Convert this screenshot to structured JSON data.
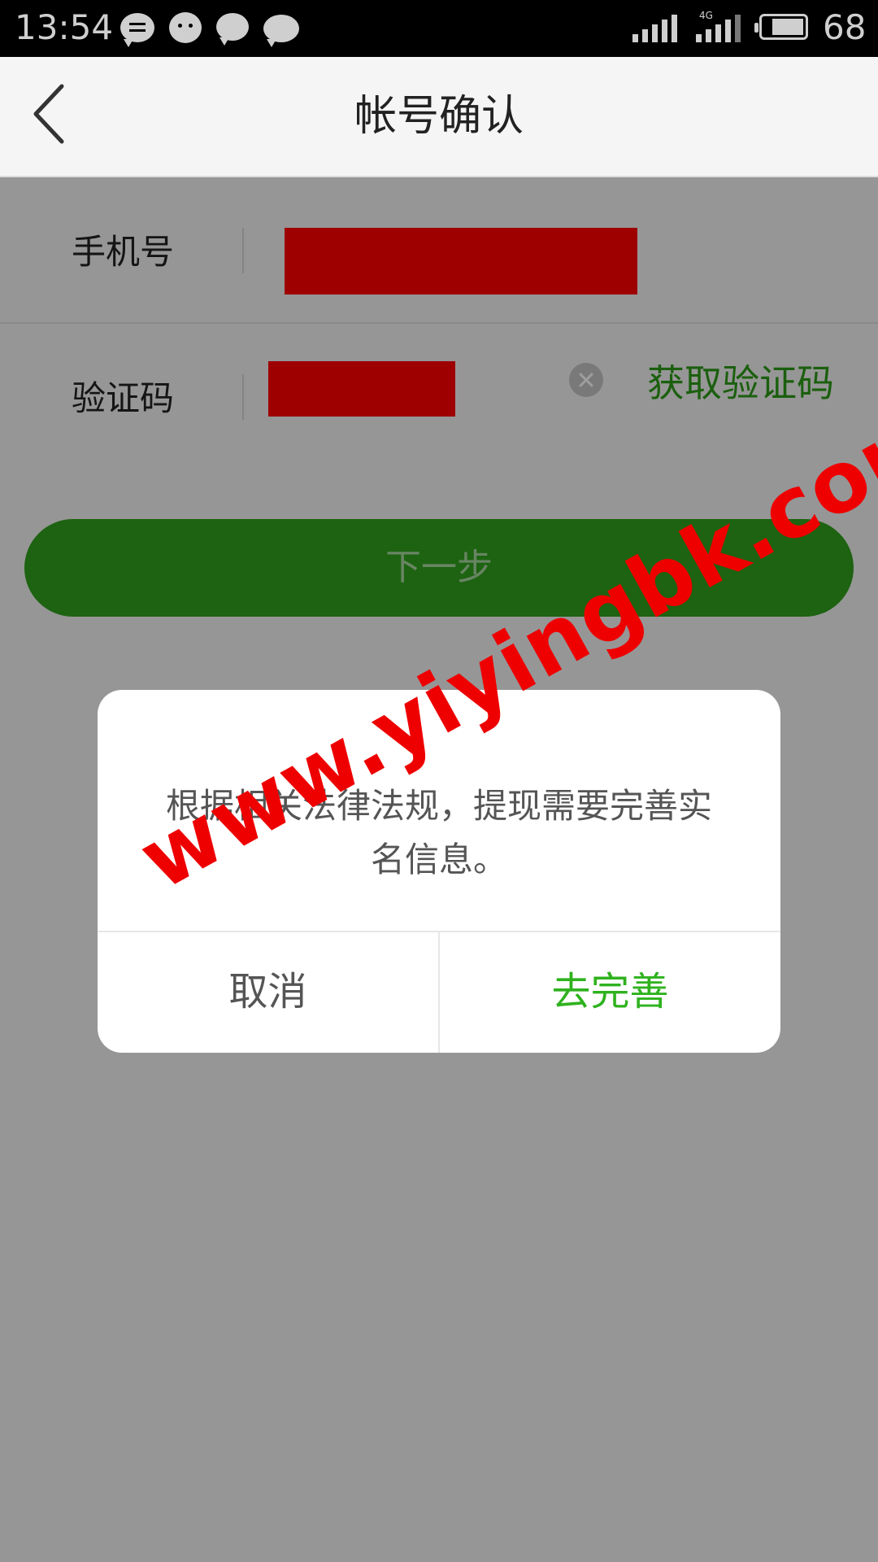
{
  "status_bar": {
    "time": "13:54",
    "network": "4G",
    "battery": "68",
    "icons": [
      "message-icon",
      "wechat-icon",
      "chat-bubble-icon",
      "chat-bubble-icon",
      "signal-icon",
      "signal-4g-icon",
      "battery-icon"
    ]
  },
  "header": {
    "title": "帐号确认",
    "back_icon": "chevron-left-icon"
  },
  "form": {
    "phone_label": "手机号",
    "code_label": "验证码",
    "get_code_label": "获取验证码",
    "clear_icon": "clear-icon",
    "next_label": "下一步"
  },
  "dialog": {
    "message": "根据相关法律法规，提现需要完善实名信息。",
    "cancel_label": "取消",
    "confirm_label": "去完善"
  },
  "watermark": {
    "text": "www.yiyingbk.com"
  },
  "colors": {
    "accent_green": "#2fa01c",
    "link_green": "#2c9a17",
    "redaction_red": "#ff0000",
    "watermark_red": "#ee0000"
  }
}
